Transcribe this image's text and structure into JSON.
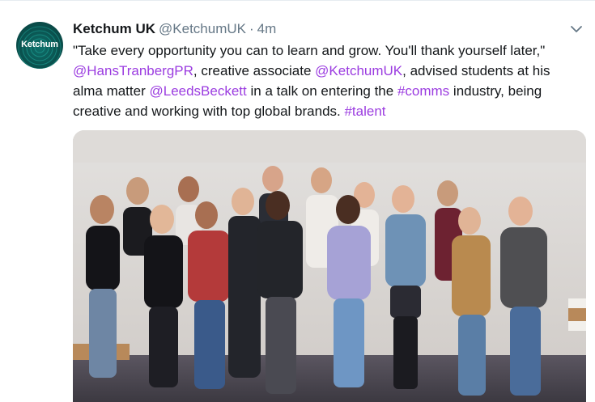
{
  "tweet": {
    "avatar_label": "Ketchum",
    "display_name": "Ketchum UK",
    "handle": "@KetchumUK",
    "separator": "·",
    "timestamp": "4m",
    "text_segments": [
      {
        "text": "\"Take every opportunity you can to learn and grow. You'll thank yourself later,\" ",
        "link": false
      },
      {
        "text": "@HansTranbergPR",
        "link": true
      },
      {
        "text": ", creative associate ",
        "link": false
      },
      {
        "text": "@KetchumUK",
        "link": true
      },
      {
        "text": ", advised students at his alma matter ",
        "link": false
      },
      {
        "text": "@LeedsBeckett",
        "link": true
      },
      {
        "text": " in a talk on entering the ",
        "link": false
      },
      {
        "text": "#comms",
        "link": true
      },
      {
        "text": " industry, being creative and working with top global brands. ",
        "link": false
      },
      {
        "text": "#talent",
        "link": true
      }
    ],
    "link_color": "#9b3ce0",
    "icons": {
      "options": "chevron-down-icon"
    }
  }
}
